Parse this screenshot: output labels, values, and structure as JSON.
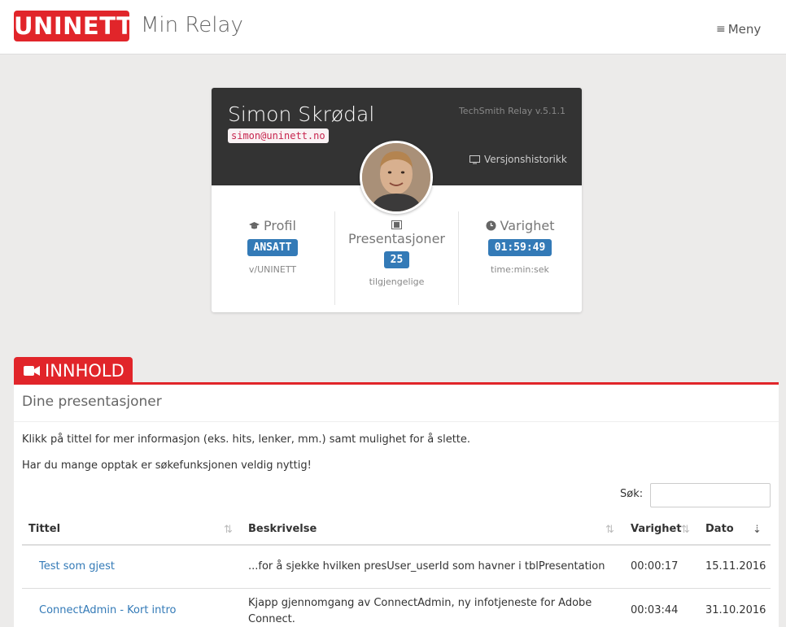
{
  "header": {
    "logo": "UNINETT",
    "app_title": "Min Relay",
    "menu_label": "Meny"
  },
  "profile": {
    "name": "Simon Skrødal",
    "email": "simon@uninett.no",
    "version": "TechSmith Relay v.5.1.1",
    "history_link": "Versjonshistorikk",
    "stats": [
      {
        "title": "Profil",
        "value": "ANSATT",
        "sub": "v/UNINETT"
      },
      {
        "title": "Presentasjoner",
        "value": "25",
        "sub": "tilgjengelige"
      },
      {
        "title": "Varighet",
        "value": "01:59:49",
        "sub": "time:min:sek"
      }
    ]
  },
  "content": {
    "tab_label": "INNHOLD",
    "panel_title": "Dine presentasjoner",
    "info1": "Klikk på tittel for mer informasjon (eks. hits, lenker, mm.) samt mulighet for å slette.",
    "info2": "Har du mange opptak er søkefunksjonen veldig nyttig!",
    "search_label": "Søk:",
    "columns": [
      "Tittel",
      "Beskrivelse",
      "Varighet",
      "Dato"
    ],
    "rows": [
      {
        "title": "Test som gjest",
        "description": "...for å sjekke hvilken presUser_userId som havner i tblPresentation",
        "duration": "00:00:17",
        "date": "15.11.2016"
      },
      {
        "title": "ConnectAdmin - Kort intro",
        "description": "Kjapp gjennomgang av ConnectAdmin, ny infotjeneste for Adobe Connect.",
        "duration": "00:03:44",
        "date": "31.10.2016"
      }
    ]
  }
}
